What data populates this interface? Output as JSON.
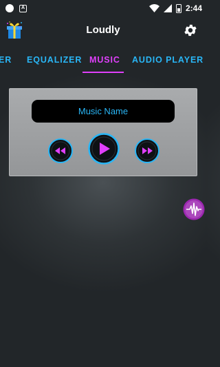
{
  "status_bar": {
    "time": "2:44",
    "app_badge": "A"
  },
  "app_bar": {
    "title": "Loudly"
  },
  "tabs": [
    {
      "label": "BOOSTER",
      "shown": "ER",
      "active": false
    },
    {
      "label": "EQUALIZER",
      "active": false
    },
    {
      "label": "MUSIC",
      "active": true
    },
    {
      "label": "AUDIO PLAYER",
      "active": false
    }
  ],
  "player": {
    "music_name": "Music Name"
  },
  "icons": {
    "gift": "gift-icon",
    "settings": "gear-icon",
    "previous": "rewind-icon",
    "play": "play-icon",
    "next": "fast-forward-icon",
    "floating": "waveform-icon"
  },
  "colors": {
    "accent_blue": "#29b6f6",
    "accent_pink": "#e040fb",
    "background": "#232629"
  }
}
